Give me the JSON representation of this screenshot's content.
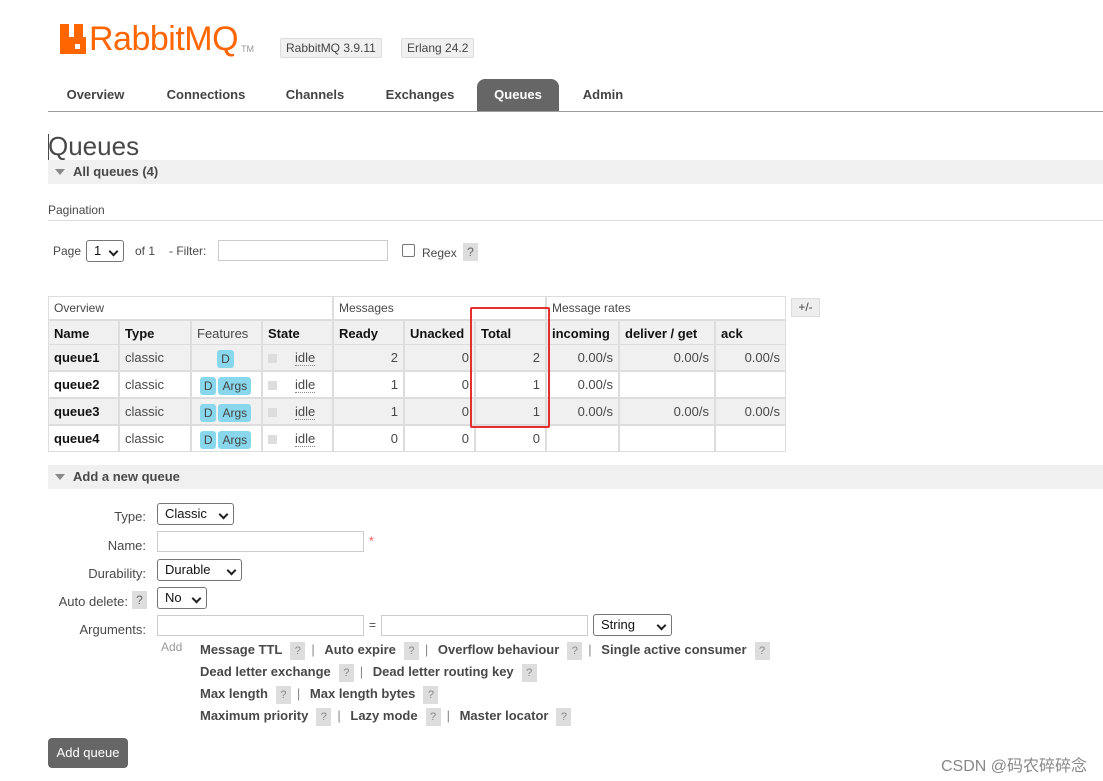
{
  "header": {
    "logo_text": "RabbitMQ",
    "logo_tm": "TM",
    "rabbitmq_version": "RabbitMQ 3.9.11",
    "erlang_version": "Erlang 24.2"
  },
  "nav": {
    "tabs": [
      "Overview",
      "Connections",
      "Channels",
      "Exchanges",
      "Queues",
      "Admin"
    ],
    "active": "Queues"
  },
  "page": {
    "title": "Queues",
    "all_queues_label": "All queues (4)",
    "pagination_label": "Pagination"
  },
  "pagination": {
    "page_label": "Page",
    "page_value": "1",
    "of_label": "of 1",
    "filter_label": "- Filter:",
    "filter_value": "",
    "regex_label": "Regex",
    "help": "?"
  },
  "table": {
    "groups": [
      "Overview",
      "Messages",
      "Message rates"
    ],
    "toggle": "+/-",
    "columns": [
      "Name",
      "Type",
      "Features",
      "State",
      "Ready",
      "Unacked",
      "Total",
      "incoming",
      "deliver / get",
      "ack"
    ],
    "rows": [
      {
        "name": "queue1",
        "type": "classic",
        "features": [
          "D"
        ],
        "state": "idle",
        "ready": "2",
        "unacked": "0",
        "total": "2",
        "incoming": "0.00/s",
        "deliver_get": "0.00/s",
        "ack": "0.00/s"
      },
      {
        "name": "queue2",
        "type": "classic",
        "features": [
          "D",
          "Args"
        ],
        "state": "idle",
        "ready": "1",
        "unacked": "0",
        "total": "1",
        "incoming": "0.00/s",
        "deliver_get": "",
        "ack": ""
      },
      {
        "name": "queue3",
        "type": "classic",
        "features": [
          "D",
          "Args"
        ],
        "state": "idle",
        "ready": "1",
        "unacked": "0",
        "total": "1",
        "incoming": "0.00/s",
        "deliver_get": "0.00/s",
        "ack": "0.00/s"
      },
      {
        "name": "queue4",
        "type": "classic",
        "features": [
          "D",
          "Args"
        ],
        "state": "idle",
        "ready": "0",
        "unacked": "0",
        "total": "0",
        "incoming": "",
        "deliver_get": "",
        "ack": ""
      }
    ]
  },
  "add_queue": {
    "section_label": "Add a new queue",
    "type_label": "Type:",
    "type_value": "Classic",
    "name_label": "Name:",
    "name_value": "",
    "required_mark": "*",
    "durability_label": "Durability:",
    "durability_value": "Durable",
    "auto_delete_label": "Auto delete:",
    "auto_delete_value": "No",
    "arguments_label": "Arguments:",
    "arguments_eq": "=",
    "arguments_type_value": "String",
    "add_label": "Add",
    "arg_rows": [
      [
        "Message TTL",
        "Auto expire",
        "Overflow behaviour",
        "Single active consumer"
      ],
      [
        "Dead letter exchange",
        "Dead letter routing key"
      ],
      [
        "Max length",
        "Max length bytes"
      ],
      [
        "Maximum priority",
        "Lazy mode",
        "Master locator"
      ]
    ],
    "submit_label": "Add queue"
  },
  "watermark": "CSDN @码农碎碎念",
  "colors": {
    "brand_orange": "#ff6600",
    "active_tab": "#666666",
    "feature_badge": "#88d7ec",
    "highlight_box": "#e52e2e"
  }
}
